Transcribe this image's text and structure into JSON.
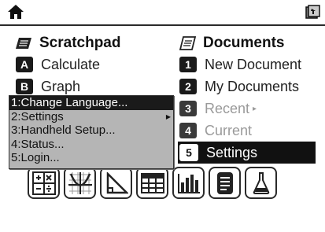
{
  "left_column": {
    "title": "Scratchpad",
    "items": [
      {
        "key": "A",
        "label": "Calculate"
      },
      {
        "key": "B",
        "label": "Graph"
      }
    ]
  },
  "right_column": {
    "title": "Documents",
    "items": [
      {
        "key": "1",
        "label": "New Document"
      },
      {
        "key": "2",
        "label": "My Documents"
      },
      {
        "key": "3",
        "label": "Recent"
      },
      {
        "key": "4",
        "label": "Current"
      },
      {
        "key": "5",
        "label": "Settings"
      }
    ]
  },
  "menu": {
    "items": [
      "1:Change Language...",
      "2:Settings",
      "3:Handheld Setup...",
      "4:Status...",
      "5:Login..."
    ]
  },
  "app_icons": [
    "calculator-icon",
    "graphs-icon",
    "geometry-icon",
    "lists-spreadsheet-icon",
    "data-statistics-icon",
    "notes-icon",
    "vernier-dataquest-icon"
  ]
}
